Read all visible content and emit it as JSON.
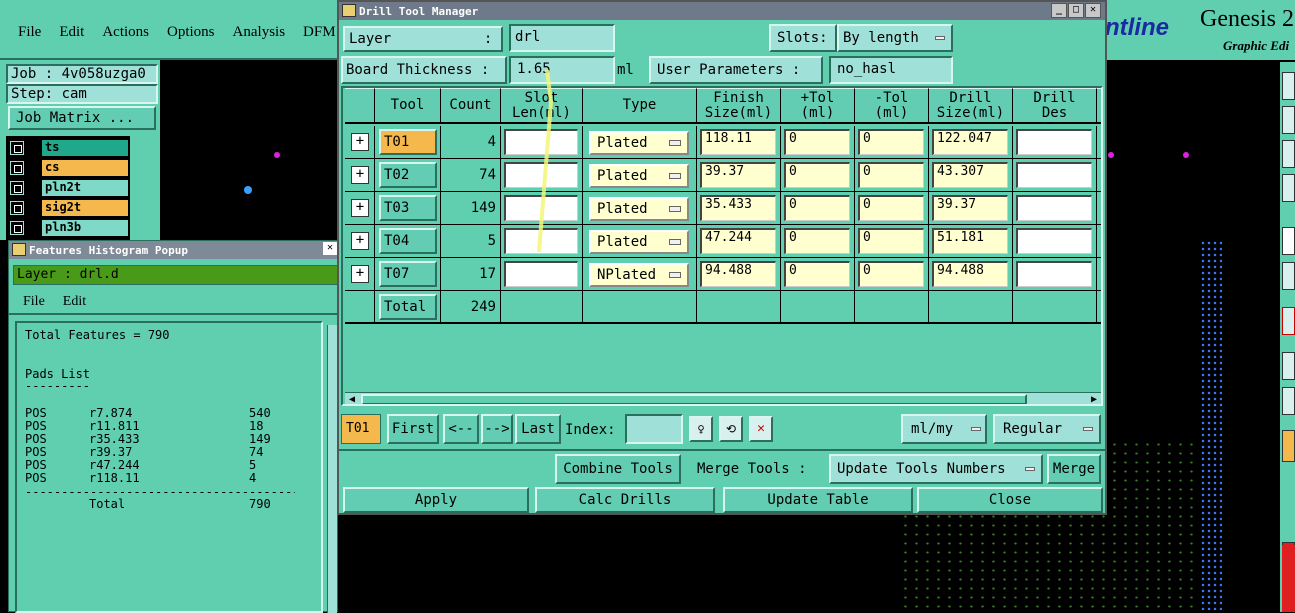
{
  "main_window": {
    "menu": [
      "File",
      "Edit",
      "Actions",
      "Options",
      "Analysis",
      "DFM"
    ],
    "brand": "ntline",
    "product": "Genesis 2",
    "product_sub": "Graphic Edi"
  },
  "job_panel": {
    "job": "Job : 4v058uzga0",
    "step": "Step: cam",
    "job_matrix": "Job Matrix ...",
    "layers": [
      {
        "name": "ts",
        "highlight": false,
        "color": "#1fa88a"
      },
      {
        "name": "cs",
        "highlight": true,
        "color": "#f4b84c"
      },
      {
        "name": "pln2t",
        "highlight": false,
        "color": "#7ed9c8"
      },
      {
        "name": "sig2t",
        "highlight": true,
        "color": "#f4b84c"
      },
      {
        "name": "pln3b",
        "highlight": false,
        "color": "#7ed9c8"
      }
    ]
  },
  "histogram": {
    "title": "Features Histogram Popup",
    "layer_label": "Layer :  drl.d",
    "menu": [
      "File",
      "Edit"
    ],
    "total_features": "Total Features = 790",
    "pads_title": "Pads List",
    "pads_rule": "---------",
    "rows": [
      {
        "kind": "POS",
        "sym": "r7.874",
        "count": "540"
      },
      {
        "kind": "POS",
        "sym": "r11.811",
        "count": "18"
      },
      {
        "kind": "POS",
        "sym": "r35.433",
        "count": "149"
      },
      {
        "kind": "POS",
        "sym": "r39.37",
        "count": "74"
      },
      {
        "kind": "POS",
        "sym": "r47.244",
        "count": "5"
      },
      {
        "kind": "POS",
        "sym": "r118.11",
        "count": "4"
      }
    ],
    "rule": "----------------------------------------",
    "total_label": "Total",
    "total_value": "790"
  },
  "dtm": {
    "title": "Drill Tool Manager",
    "layer_label": "Layer           :",
    "layer_value": "drl",
    "slots_label": "Slots:",
    "slots_value": "By length",
    "thickness_label": "Board Thickness :",
    "thickness_value": "1.65",
    "thickness_unit": "ml",
    "user_params_label": "User Parameters :",
    "user_params_value": "no_hasl",
    "headers": {
      "tool": "Tool",
      "count": "Count",
      "slot_len_1": "Slot",
      "slot_len_2": "Len(ml)",
      "type": "Type",
      "finish_1": "Finish",
      "finish_2": "Size(ml)",
      "ptol_1": "+Tol",
      "ptol_2": "(ml)",
      "mtol_1": "-Tol",
      "mtol_2": "(ml)",
      "drill_1": "Drill",
      "drill_2": "Size(ml)",
      "des_1": "Drill",
      "des_2": "Des"
    },
    "rows": [
      {
        "tool": "T01",
        "count": "4",
        "slot": "",
        "type": "Plated",
        "finish": "118.11",
        "ptol": "0",
        "mtol": "0",
        "drill": "122.047",
        "des": "",
        "selected": true
      },
      {
        "tool": "T02",
        "count": "74",
        "slot": "",
        "type": "Plated",
        "finish": "39.37",
        "ptol": "0",
        "mtol": "0",
        "drill": "43.307",
        "des": "",
        "selected": false
      },
      {
        "tool": "T03",
        "count": "149",
        "slot": "",
        "type": "Plated",
        "finish": "35.433",
        "ptol": "0",
        "mtol": "0",
        "drill": "39.37",
        "des": "",
        "selected": false
      },
      {
        "tool": "T04",
        "count": "5",
        "slot": "",
        "type": "Plated",
        "finish": "47.244",
        "ptol": "0",
        "mtol": "0",
        "drill": "51.181",
        "des": "",
        "selected": false
      },
      {
        "tool": "T07",
        "count": "17",
        "slot": "",
        "type": "NPlated",
        "finish": "94.488",
        "ptol": "0",
        "mtol": "0",
        "drill": "94.488",
        "des": "",
        "selected": false
      }
    ],
    "total_label": "Total",
    "total_value": "249",
    "nav": {
      "current": "T01",
      "first": "First",
      "prev": "<--",
      "next": "-->",
      "last": "Last",
      "index_label": "Index:",
      "units": "ml/my",
      "mode": "Regular"
    },
    "combine_tools": "Combine Tools",
    "merge_tools_label": "Merge Tools :",
    "merge_option": "Update Tools Numbers",
    "merge": "Merge",
    "apply": "Apply",
    "calc_drills": "Calc Drills",
    "update_table": "Update Table",
    "close": "Close"
  }
}
